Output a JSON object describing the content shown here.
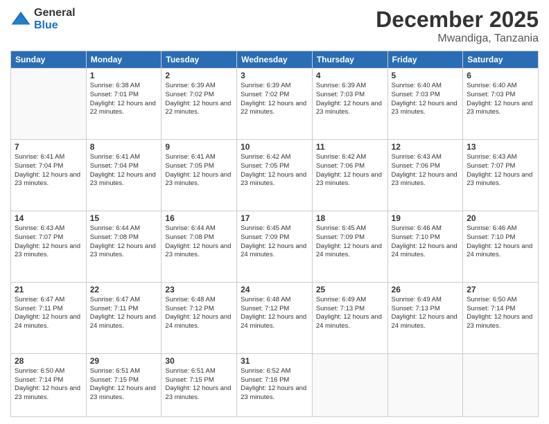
{
  "logo": {
    "general": "General",
    "blue": "Blue"
  },
  "header": {
    "month": "December 2025",
    "location": "Mwandiga, Tanzania"
  },
  "weekdays": [
    "Sunday",
    "Monday",
    "Tuesday",
    "Wednesday",
    "Thursday",
    "Friday",
    "Saturday"
  ],
  "weeks": [
    [
      {
        "day": "",
        "sunrise": "",
        "sunset": "",
        "daylight": ""
      },
      {
        "day": "1",
        "sunrise": "Sunrise: 6:38 AM",
        "sunset": "Sunset: 7:01 PM",
        "daylight": "Daylight: 12 hours and 22 minutes."
      },
      {
        "day": "2",
        "sunrise": "Sunrise: 6:39 AM",
        "sunset": "Sunset: 7:02 PM",
        "daylight": "Daylight: 12 hours and 22 minutes."
      },
      {
        "day": "3",
        "sunrise": "Sunrise: 6:39 AM",
        "sunset": "Sunset: 7:02 PM",
        "daylight": "Daylight: 12 hours and 22 minutes."
      },
      {
        "day": "4",
        "sunrise": "Sunrise: 6:39 AM",
        "sunset": "Sunset: 7:03 PM",
        "daylight": "Daylight: 12 hours and 23 minutes."
      },
      {
        "day": "5",
        "sunrise": "Sunrise: 6:40 AM",
        "sunset": "Sunset: 7:03 PM",
        "daylight": "Daylight: 12 hours and 23 minutes."
      },
      {
        "day": "6",
        "sunrise": "Sunrise: 6:40 AM",
        "sunset": "Sunset: 7:03 PM",
        "daylight": "Daylight: 12 hours and 23 minutes."
      }
    ],
    [
      {
        "day": "7",
        "sunrise": "Sunrise: 6:41 AM",
        "sunset": "Sunset: 7:04 PM",
        "daylight": "Daylight: 12 hours and 23 minutes."
      },
      {
        "day": "8",
        "sunrise": "Sunrise: 6:41 AM",
        "sunset": "Sunset: 7:04 PM",
        "daylight": "Daylight: 12 hours and 23 minutes."
      },
      {
        "day": "9",
        "sunrise": "Sunrise: 6:41 AM",
        "sunset": "Sunset: 7:05 PM",
        "daylight": "Daylight: 12 hours and 23 minutes."
      },
      {
        "day": "10",
        "sunrise": "Sunrise: 6:42 AM",
        "sunset": "Sunset: 7:05 PM",
        "daylight": "Daylight: 12 hours and 23 minutes."
      },
      {
        "day": "11",
        "sunrise": "Sunrise: 6:42 AM",
        "sunset": "Sunset: 7:06 PM",
        "daylight": "Daylight: 12 hours and 23 minutes."
      },
      {
        "day": "12",
        "sunrise": "Sunrise: 6:43 AM",
        "sunset": "Sunset: 7:06 PM",
        "daylight": "Daylight: 12 hours and 23 minutes."
      },
      {
        "day": "13",
        "sunrise": "Sunrise: 6:43 AM",
        "sunset": "Sunset: 7:07 PM",
        "daylight": "Daylight: 12 hours and 23 minutes."
      }
    ],
    [
      {
        "day": "14",
        "sunrise": "Sunrise: 6:43 AM",
        "sunset": "Sunset: 7:07 PM",
        "daylight": "Daylight: 12 hours and 23 minutes."
      },
      {
        "day": "15",
        "sunrise": "Sunrise: 6:44 AM",
        "sunset": "Sunset: 7:08 PM",
        "daylight": "Daylight: 12 hours and 23 minutes."
      },
      {
        "day": "16",
        "sunrise": "Sunrise: 6:44 AM",
        "sunset": "Sunset: 7:08 PM",
        "daylight": "Daylight: 12 hours and 23 minutes."
      },
      {
        "day": "17",
        "sunrise": "Sunrise: 6:45 AM",
        "sunset": "Sunset: 7:09 PM",
        "daylight": "Daylight: 12 hours and 24 minutes."
      },
      {
        "day": "18",
        "sunrise": "Sunrise: 6:45 AM",
        "sunset": "Sunset: 7:09 PM",
        "daylight": "Daylight: 12 hours and 24 minutes."
      },
      {
        "day": "19",
        "sunrise": "Sunrise: 6:46 AM",
        "sunset": "Sunset: 7:10 PM",
        "daylight": "Daylight: 12 hours and 24 minutes."
      },
      {
        "day": "20",
        "sunrise": "Sunrise: 6:46 AM",
        "sunset": "Sunset: 7:10 PM",
        "daylight": "Daylight: 12 hours and 24 minutes."
      }
    ],
    [
      {
        "day": "21",
        "sunrise": "Sunrise: 6:47 AM",
        "sunset": "Sunset: 7:11 PM",
        "daylight": "Daylight: 12 hours and 24 minutes."
      },
      {
        "day": "22",
        "sunrise": "Sunrise: 6:47 AM",
        "sunset": "Sunset: 7:11 PM",
        "daylight": "Daylight: 12 hours and 24 minutes."
      },
      {
        "day": "23",
        "sunrise": "Sunrise: 6:48 AM",
        "sunset": "Sunset: 7:12 PM",
        "daylight": "Daylight: 12 hours and 24 minutes."
      },
      {
        "day": "24",
        "sunrise": "Sunrise: 6:48 AM",
        "sunset": "Sunset: 7:12 PM",
        "daylight": "Daylight: 12 hours and 24 minutes."
      },
      {
        "day": "25",
        "sunrise": "Sunrise: 6:49 AM",
        "sunset": "Sunset: 7:13 PM",
        "daylight": "Daylight: 12 hours and 24 minutes."
      },
      {
        "day": "26",
        "sunrise": "Sunrise: 6:49 AM",
        "sunset": "Sunset: 7:13 PM",
        "daylight": "Daylight: 12 hours and 24 minutes."
      },
      {
        "day": "27",
        "sunrise": "Sunrise: 6:50 AM",
        "sunset": "Sunset: 7:14 PM",
        "daylight": "Daylight: 12 hours and 23 minutes."
      }
    ],
    [
      {
        "day": "28",
        "sunrise": "Sunrise: 6:50 AM",
        "sunset": "Sunset: 7:14 PM",
        "daylight": "Daylight: 12 hours and 23 minutes."
      },
      {
        "day": "29",
        "sunrise": "Sunrise: 6:51 AM",
        "sunset": "Sunset: 7:15 PM",
        "daylight": "Daylight: 12 hours and 23 minutes."
      },
      {
        "day": "30",
        "sunrise": "Sunrise: 6:51 AM",
        "sunset": "Sunset: 7:15 PM",
        "daylight": "Daylight: 12 hours and 23 minutes."
      },
      {
        "day": "31",
        "sunrise": "Sunrise: 6:52 AM",
        "sunset": "Sunset: 7:16 PM",
        "daylight": "Daylight: 12 hours and 23 minutes."
      },
      {
        "day": "",
        "sunrise": "",
        "sunset": "",
        "daylight": ""
      },
      {
        "day": "",
        "sunrise": "",
        "sunset": "",
        "daylight": ""
      },
      {
        "day": "",
        "sunrise": "",
        "sunset": "",
        "daylight": ""
      }
    ]
  ]
}
